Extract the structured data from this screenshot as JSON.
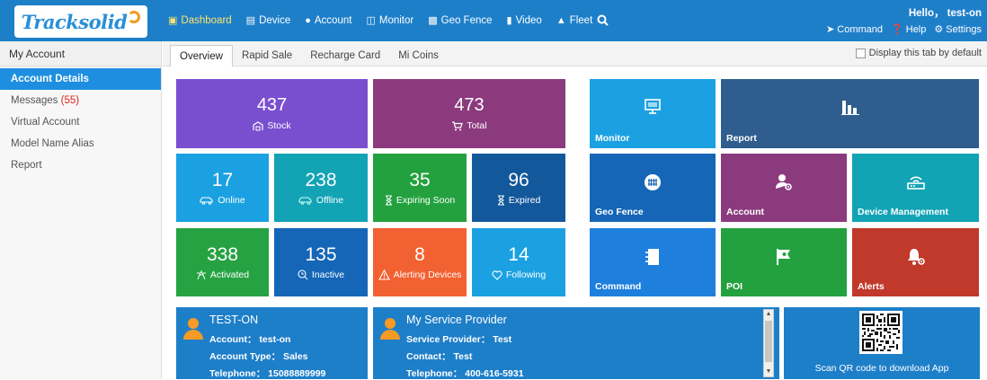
{
  "header": {
    "logo_text": "Tracksolid",
    "nav": [
      {
        "label": "Dashboard",
        "icon": "dashboard-icon"
      },
      {
        "label": "Device",
        "icon": "device-icon"
      },
      {
        "label": "Account",
        "icon": "users-icon"
      },
      {
        "label": "Monitor",
        "icon": "map-icon"
      },
      {
        "label": "Geo Fence",
        "icon": "geofence-icon"
      },
      {
        "label": "Video",
        "icon": "video-icon"
      },
      {
        "label": "Fleet",
        "icon": "car-icon"
      }
    ],
    "greeting": "Hello， test-on",
    "actions": {
      "command": "Command",
      "help": "Help",
      "settings": "Settings"
    }
  },
  "sidebar": {
    "title": "My Account",
    "items": [
      {
        "label": "Account Details"
      },
      {
        "label": "Messages ",
        "count": "(55)"
      },
      {
        "label": "Virtual Account"
      },
      {
        "label": "Model Name Alias"
      },
      {
        "label": "Report"
      }
    ]
  },
  "tabs": [
    "Overview",
    "Rapid Sale",
    "Recharge Card",
    "Mi Coins"
  ],
  "default_tab_label": "Display this tab by default",
  "stats": {
    "stock": {
      "value": "437",
      "label": "Stock"
    },
    "total": {
      "value": "473",
      "label": "Total"
    },
    "online": {
      "value": "17",
      "label": "Online"
    },
    "offline": {
      "value": "238",
      "label": "Offline"
    },
    "expiring": {
      "value": "35",
      "label": "Expiring Soon"
    },
    "expired": {
      "value": "96",
      "label": "Expired"
    },
    "activated": {
      "value": "338",
      "label": "Activated"
    },
    "inactive": {
      "value": "135",
      "label": "Inactive"
    },
    "alerting": {
      "value": "8",
      "label": "Alerting Devices"
    },
    "following": {
      "value": "14",
      "label": "Following"
    }
  },
  "shortcuts": {
    "monitor": "Monitor",
    "report": "Report",
    "geofence": "Geo Fence",
    "account": "Account",
    "device_management": "Device Management",
    "command": "Command",
    "poi": "POI",
    "alerts": "Alerts"
  },
  "account_card": {
    "title": "TEST-ON",
    "account": "Account： test-on",
    "type": "Account Type： Sales",
    "telephone": "Telephone： 15088889999"
  },
  "provider_card": {
    "title": "My Service Provider",
    "provider": "Service Provider： Test",
    "contact": "Contact： Test",
    "telephone": "Telephone： 400-616-5931"
  },
  "app_card": {
    "caption": "Scan QR code to download App"
  },
  "colors": {
    "topbar": "#1e7fc9",
    "stock": "#7a4fcf",
    "total": "#8c3a7e",
    "online": "#1ba1e2",
    "offline": "#12a3b5",
    "expiring": "#24a13f",
    "expired": "#12589b",
    "activated": "#27a243",
    "inactive": "#1566b7",
    "alerting": "#f26131",
    "following": "#1ba1e2"
  }
}
